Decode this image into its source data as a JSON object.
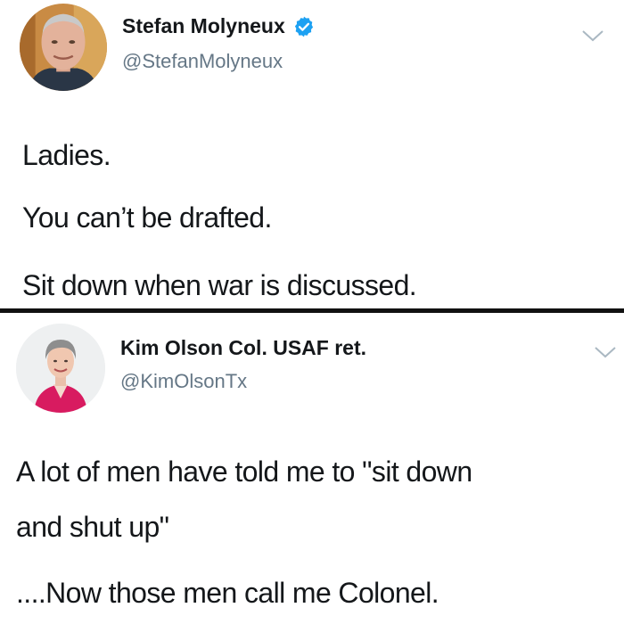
{
  "tweets": [
    {
      "author_name": "Stefan Molyneux",
      "handle": "@StefanMolyneux",
      "verified": true,
      "lines": [
        "Ladies.",
        "You can’t be drafted.",
        "Sit down when war is discussed."
      ]
    },
    {
      "author_name": "Kim Olson Col. USAF ret.",
      "handle": "@KimOlsonTx",
      "verified": false,
      "lines": [
        "A lot of men have told me to \"sit down",
        "and shut up\"",
        "....Now those men call me Colonel."
      ]
    }
  ],
  "icons": {
    "verified": "verified-badge-icon",
    "menu": "chevron-down-icon"
  },
  "colors": {
    "verified_blue": "#1da1f2",
    "handle_gray": "#657786",
    "text": "#14171a"
  }
}
